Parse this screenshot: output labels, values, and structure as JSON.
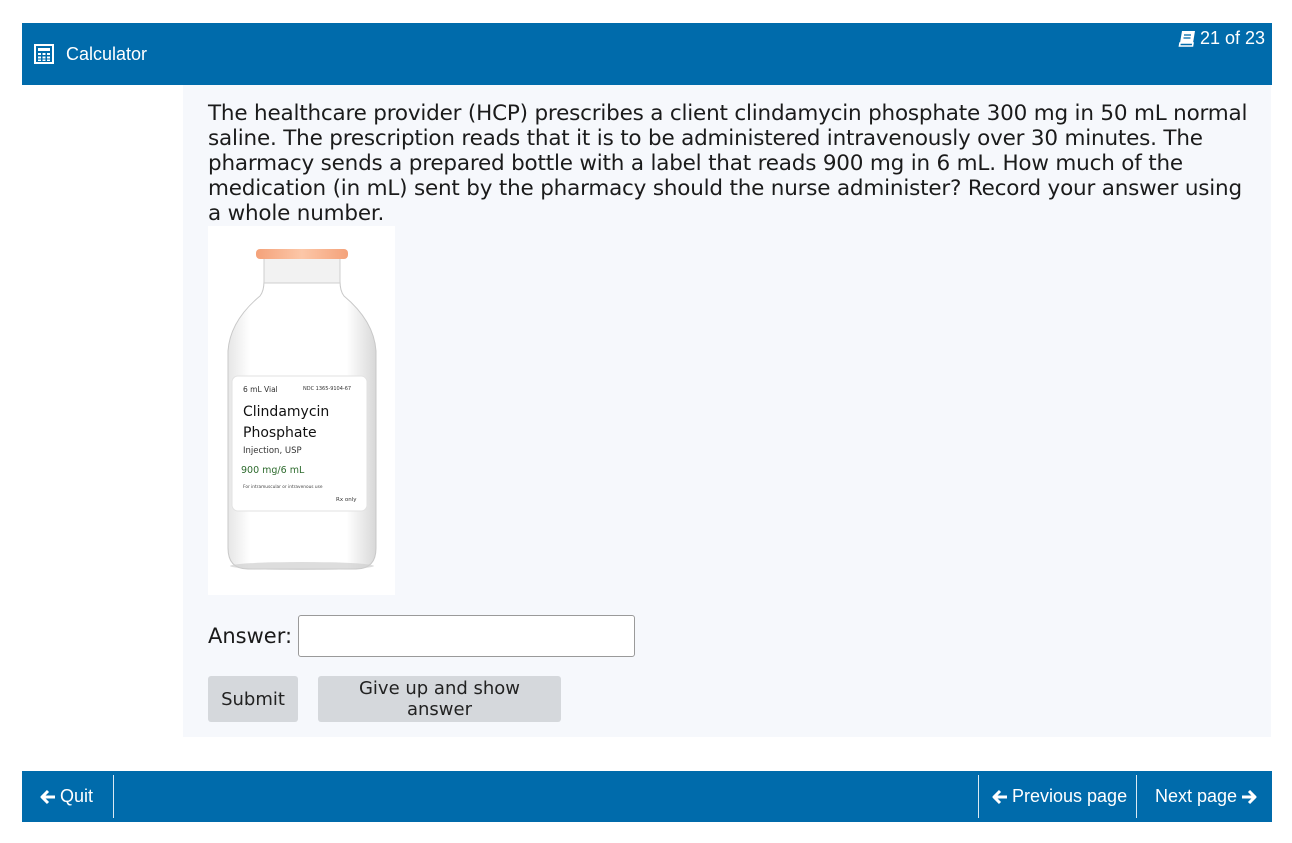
{
  "header": {
    "calculator_label": "Calculator",
    "calculator_icon": "calculator-icon",
    "page_counter": "21 of 23",
    "page_icon": "book-icon",
    "bg_color": "#006bab"
  },
  "question": {
    "text": "The healthcare provider (HCP) prescribes a client clindamycin phosphate 300 mg in 50 mL normal saline. The prescription reads that it is to be administered intravenously over 30 minutes. The pharmacy sends a prepared bottle with a label that reads 900 mg in 6 mL. How much of the medication (in mL) sent by the pharmacy should the nurse administer? Record your answer using a whole number."
  },
  "vial_label": {
    "volume": "6 mL Vial",
    "ndc": "NDC 1365-9104-67",
    "name_line1": "Clindamycin",
    "name_line2": "Phosphate",
    "form": "Injection, USP",
    "strength": "900 mg/6 mL",
    "route": "For intramuscular or intravenous use",
    "rx": "Rx only"
  },
  "answer": {
    "label": "Answer:",
    "value": "",
    "placeholder": ""
  },
  "buttons": {
    "submit": "Submit",
    "give_up": "Give up and show answer"
  },
  "footer": {
    "quit": "Quit",
    "previous": "Previous page",
    "next": "Next page"
  }
}
